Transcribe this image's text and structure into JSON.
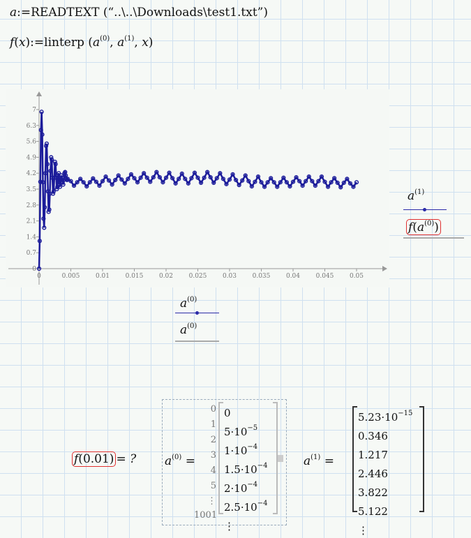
{
  "worksheet": {
    "line1": {
      "var": "a",
      "assign": ":=",
      "func": "READTEXT",
      "arg": "“..\\..\\Downloads\\test1.txt”"
    },
    "line2": {
      "func": "f",
      "param": "x",
      "assign": ":=",
      "call": "linterp",
      "arg0": "a",
      "sup0": "(0)",
      "arg1": "a",
      "sup1": "(1)",
      "arg2": "x"
    }
  },
  "legend": {
    "y_label": "a",
    "y_sup": "(1)",
    "y2_func": "f",
    "y2_arg": "a",
    "y2_sup": "(0)",
    "x_label": "a",
    "x_sup": "(0)",
    "x2_label": "a",
    "x2_sup": "(0)"
  },
  "eval": {
    "func": "f",
    "arg": "0.01",
    "result": "= ?"
  },
  "matrix_a0": {
    "label": "a",
    "sup": "(0)",
    "eq": "=",
    "indices": [
      "0",
      "1",
      "2",
      "3",
      "4",
      "5",
      "⋮",
      "1001"
    ],
    "rows": [
      {
        "m": "0",
        "e": ""
      },
      {
        "m": "5·10",
        "e": "−5"
      },
      {
        "m": "1·10",
        "e": "−4"
      },
      {
        "m": "1.5·10",
        "e": "−4"
      },
      {
        "m": "2·10",
        "e": "−4"
      },
      {
        "m": "2.5·10",
        "e": "−4"
      },
      {
        "m": "⋮",
        "e": ""
      }
    ]
  },
  "matrix_a1": {
    "label": "a",
    "sup": "(1)",
    "eq": "=",
    "rows": [
      {
        "m": "5.23·10",
        "e": "−15"
      },
      {
        "m": "0.346",
        "e": ""
      },
      {
        "m": "1.217",
        "e": ""
      },
      {
        "m": "2.446",
        "e": ""
      },
      {
        "m": "3.822",
        "e": ""
      },
      {
        "m": "5.122",
        "e": ""
      },
      {
        "m": "⋮",
        "e": ""
      }
    ]
  },
  "colors": {
    "trace": "#1c1c9a",
    "highlight": "#e03030"
  },
  "chart_data": {
    "type": "line",
    "xlim": [
      0,
      0.05
    ],
    "ylim": [
      0,
      7
    ],
    "xticks": [
      "0",
      "0.005",
      "0.01",
      "0.015",
      "0.02",
      "0.025",
      "0.03",
      "0.035",
      "0.04",
      "0.045",
      "0.05"
    ],
    "xtick_values": [
      0,
      0.005,
      0.01,
      0.015,
      0.02,
      0.025,
      0.03,
      0.035,
      0.04,
      0.045,
      0.05
    ],
    "yticks": [
      "0",
      "0.7",
      "1.4",
      "2.1",
      "2.8",
      "3.5",
      "4.2",
      "4.9",
      "5.6",
      "6.3",
      "7"
    ],
    "ytick_values": [
      0,
      0.7,
      1.4,
      2.1,
      2.8,
      3.5,
      4.2,
      4.9,
      5.6,
      6.3,
      7
    ],
    "series": [
      {
        "name": "a(1) vs a(0)",
        "segments": [
          {
            "x_start": 0,
            "x_step": 0.0001,
            "y": [
              0,
              1.217,
              3.822,
              6.1,
              6.9,
              5.9,
              3.8,
              2.2,
              1.8,
              2.7,
              4.2,
              5.4,
              5.5,
              4.6,
              3.4,
              2.5,
              2.6,
              3.3,
              4.3,
              4.9,
              4.8,
              4.0,
              3.3,
              3.4,
              4.0,
              4.7,
              4.6,
              4.0,
              3.5,
              3.6,
              4.1,
              4.2,
              3.8,
              3.6,
              3.9,
              4.1,
              4.0,
              3.8,
              3.7,
              3.9,
              4.2,
              4.25,
              4.1,
              3.95,
              3.9,
              3.95
            ]
          },
          {
            "x_start": 0.005,
            "x_step": 0.0005,
            "y": [
              3.85,
              3.65,
              3.8,
              3.95,
              3.8,
              3.62,
              3.8,
              3.97,
              3.82,
              3.65,
              3.85,
              4.05,
              3.88,
              3.7,
              3.9,
              4.1,
              3.92,
              3.75,
              3.95,
              4.15,
              3.98,
              3.8,
              4.0,
              4.2,
              4.0,
              3.82,
              4.02,
              4.25,
              4.02,
              3.8,
              4.0,
              4.22,
              3.98,
              3.75,
              3.95,
              4.18,
              3.95,
              3.75,
              3.98,
              4.22,
              4.0,
              3.78,
              4.0,
              4.25,
              4.02,
              3.78,
              3.98,
              4.2,
              3.95,
              3.72,
              3.92,
              4.15,
              3.9,
              3.68,
              3.88,
              4.1,
              3.85,
              3.62,
              3.82,
              4.05,
              3.8,
              3.6,
              3.8,
              3.98,
              3.8,
              3.6,
              3.8,
              4.0,
              3.8,
              3.62,
              3.82,
              4.02,
              3.85,
              3.65,
              3.85,
              4.05,
              3.85,
              3.65,
              3.85,
              4.05,
              3.82,
              3.6,
              3.8,
              3.98,
              3.78,
              3.58,
              3.78,
              3.95,
              3.75,
              3.6,
              3.8
            ]
          }
        ]
      }
    ]
  }
}
